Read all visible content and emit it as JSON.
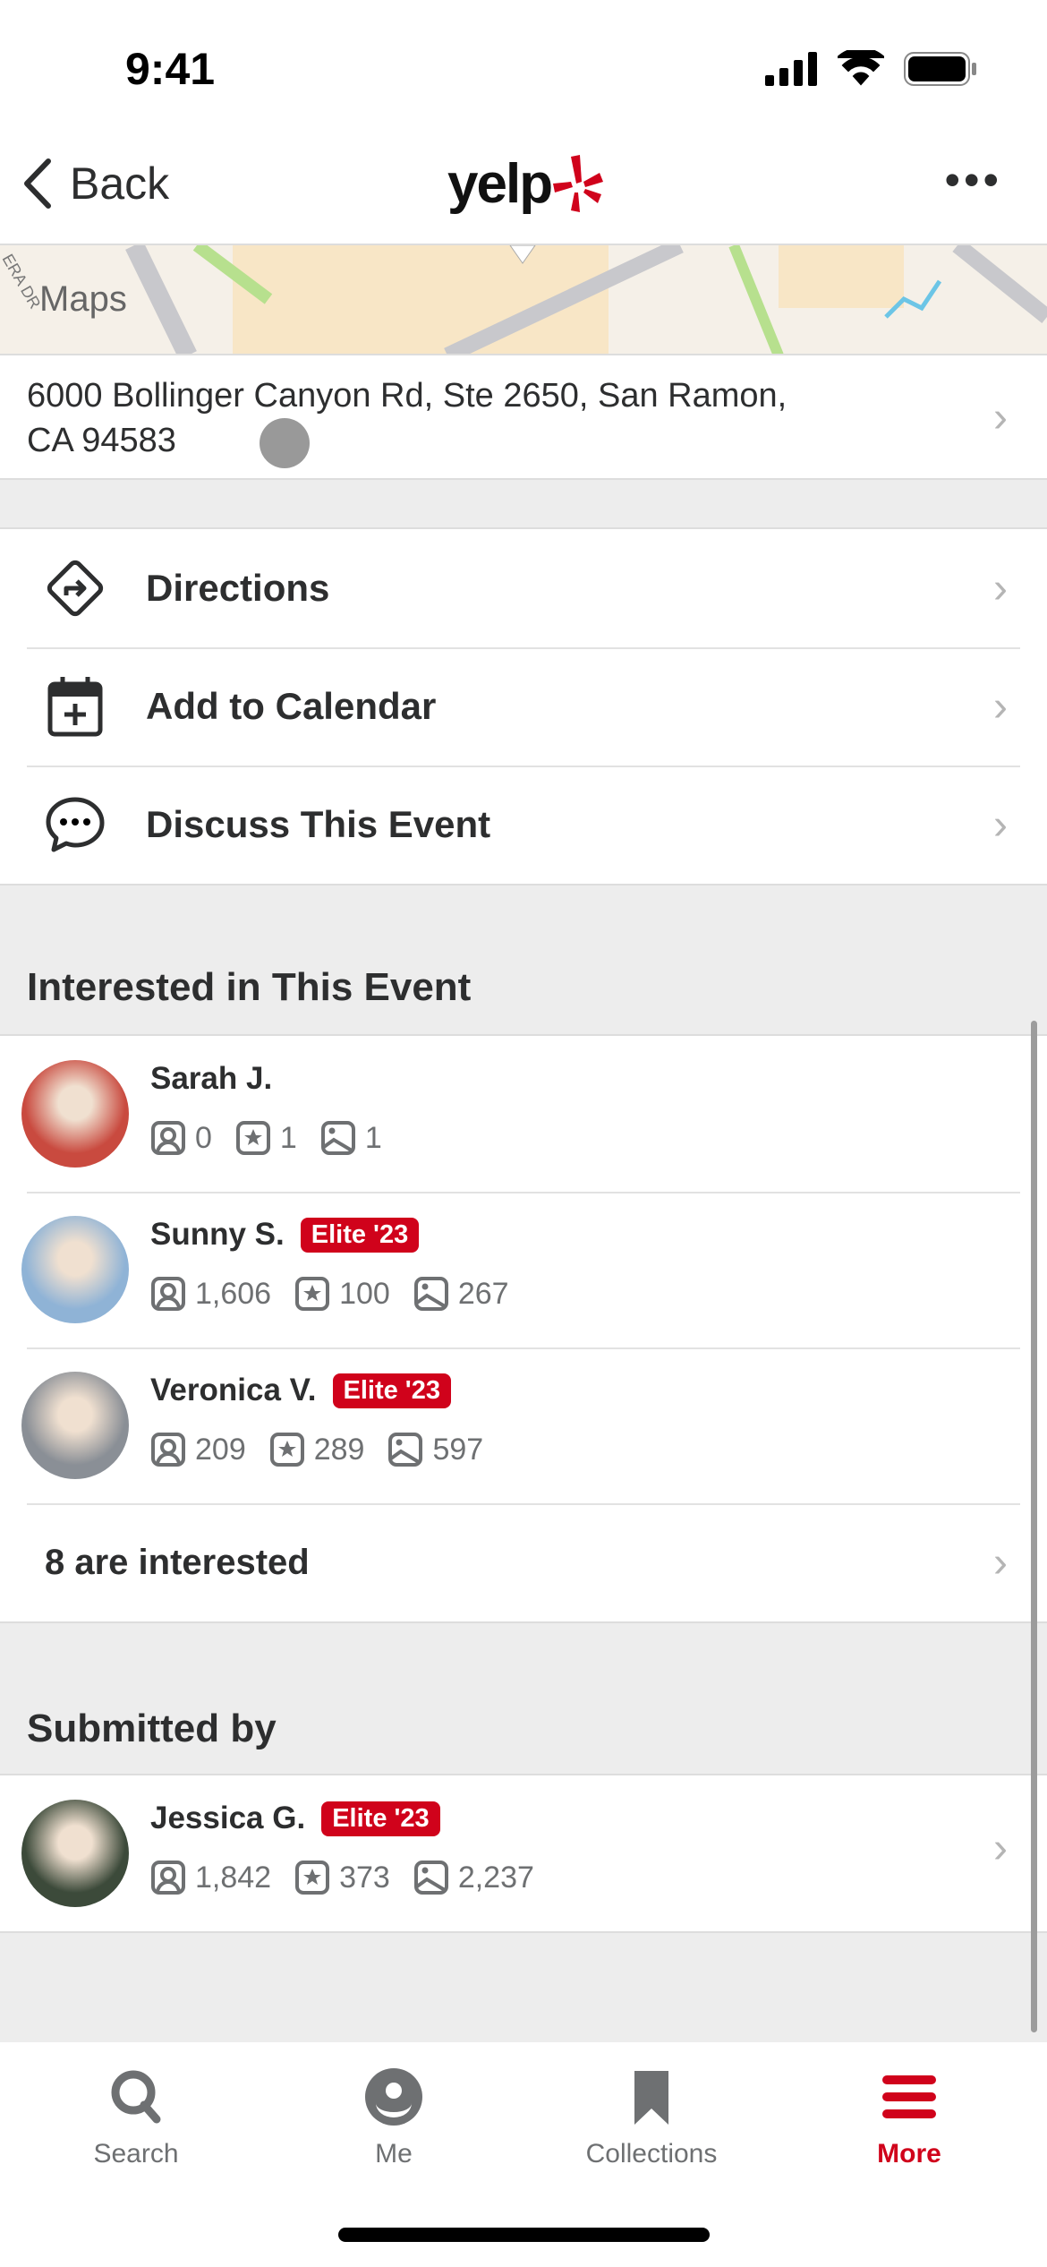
{
  "status_bar": {
    "time": "9:41"
  },
  "nav": {
    "back_label": "Back",
    "logo": "yelp",
    "more_icon": "ellipsis-icon"
  },
  "map": {
    "attribution": "Maps",
    "street_label": "ERA DR"
  },
  "address": {
    "line1": "6000 Bollinger Canyon Rd, Ste 2650, San Ramon,",
    "line2": "CA 94583"
  },
  "actions": [
    {
      "label": "Directions",
      "icon": "directions-icon"
    },
    {
      "label": "Add to Calendar",
      "icon": "calendar-add-icon"
    },
    {
      "label": "Discuss This Event",
      "icon": "chat-bubble-icon"
    }
  ],
  "interested": {
    "title": "Interested in This Event",
    "users": [
      {
        "name": "Sarah J.",
        "elite": "",
        "friends": "0",
        "reviews": "1",
        "photos": "1",
        "avatar_color": "#c94a3f"
      },
      {
        "name": "Sunny S.",
        "elite": "Elite '23",
        "friends": "1,606",
        "reviews": "100",
        "photos": "267",
        "avatar_color": "#8fb3d6"
      },
      {
        "name": "Veronica V.",
        "elite": "Elite '23",
        "friends": "209",
        "reviews": "289",
        "photos": "597",
        "avatar_color": "#8a8f96"
      }
    ],
    "more_label": "8 are interested"
  },
  "submitted": {
    "title": "Submitted by",
    "user": {
      "name": "Jessica G.",
      "elite": "Elite '23",
      "friends": "1,842",
      "reviews": "373",
      "photos": "2,237",
      "avatar_color": "#3c4a3a"
    }
  },
  "tabbar": {
    "items": [
      {
        "label": "Search",
        "icon": "search-icon",
        "active": false
      },
      {
        "label": "Me",
        "icon": "user-icon",
        "active": false
      },
      {
        "label": "Collections",
        "icon": "bookmark-icon",
        "active": false
      },
      {
        "label": "More",
        "icon": "menu-icon",
        "active": true
      }
    ]
  },
  "colors": {
    "brand_red": "#d0021b",
    "text": "#2d2e2f",
    "muted": "#6e7072"
  }
}
